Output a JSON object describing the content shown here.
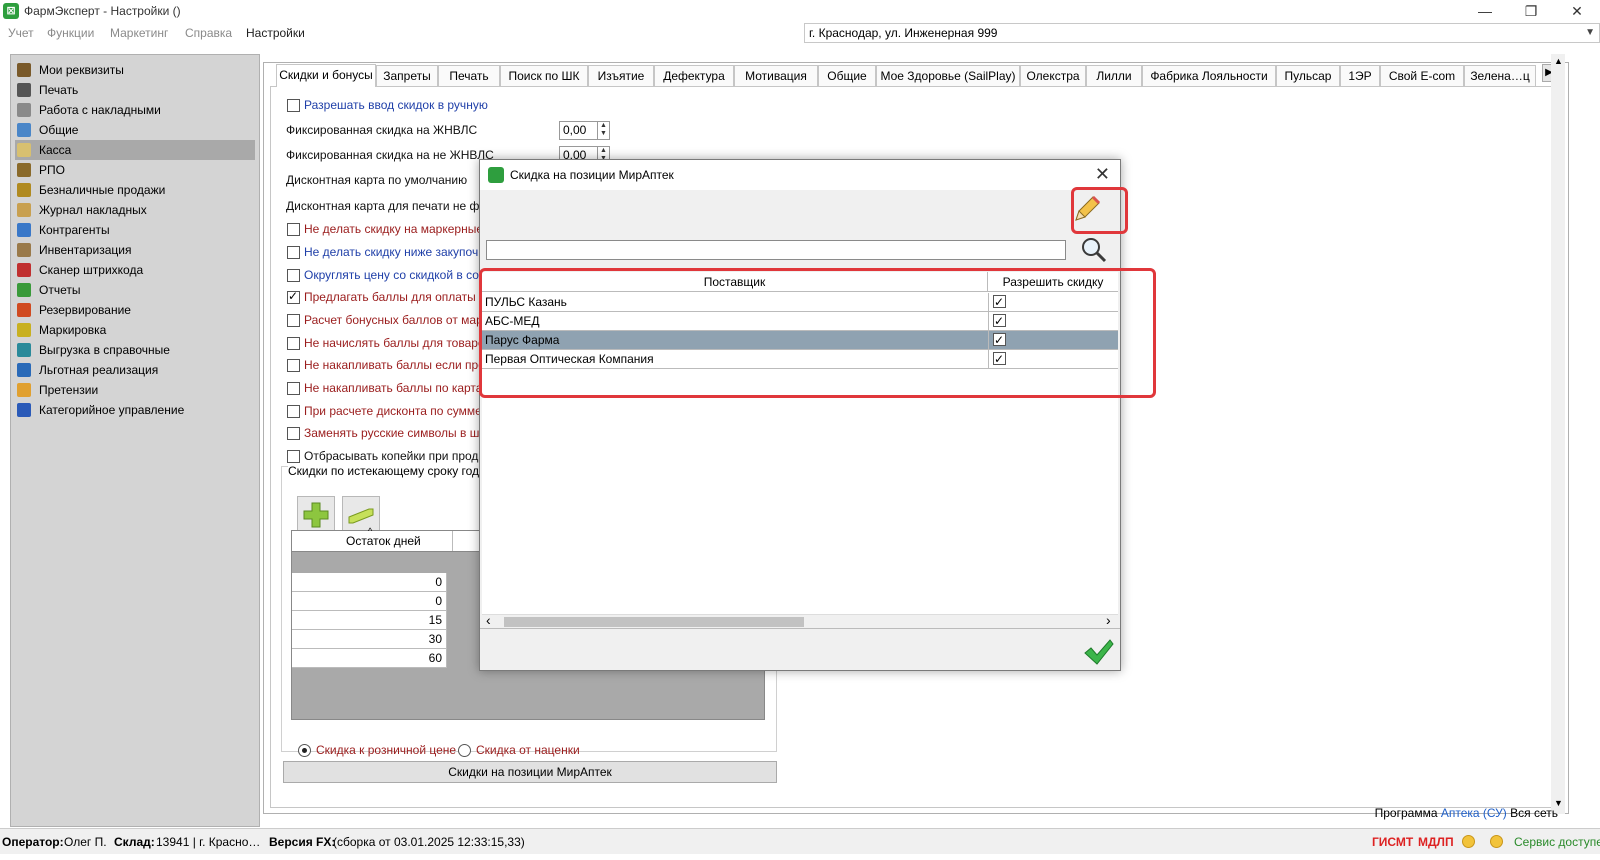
{
  "window": {
    "title": "ФармЭксперт - Настройки ()",
    "minimize": "—",
    "maximize": "❐",
    "close": "✕"
  },
  "menu": [
    "Учет",
    "Функции",
    "Маркетинг",
    "Справка",
    "Настройки"
  ],
  "address": "г. Краснодар, ул. Инженерная 999",
  "sidebar": {
    "items": [
      {
        "label": "Мои реквизиты",
        "color": "#7a5a2a"
      },
      {
        "label": "Печать",
        "color": "#555555"
      },
      {
        "label": "Работа с накладными",
        "color": "#8a8a8a"
      },
      {
        "label": "Общие",
        "color": "#4a86c8"
      },
      {
        "label": "Касса",
        "color": "#d8c070",
        "selected": true
      },
      {
        "label": "РПО",
        "color": "#8a6a2a"
      },
      {
        "label": "Безналичные продажи",
        "color": "#b08a20"
      },
      {
        "label": "Журнал накладных",
        "color": "#c8a050"
      },
      {
        "label": "Контрагенты",
        "color": "#3a78c8"
      },
      {
        "label": "Инвентаризация",
        "color": "#9a7a4a"
      },
      {
        "label": "Сканер штрихкода",
        "color": "#c03030"
      },
      {
        "label": "Отчеты",
        "color": "#3a9a3a"
      },
      {
        "label": "Резервирование",
        "color": "#d04a20"
      },
      {
        "label": "Маркировка",
        "color": "#c8b020"
      },
      {
        "label": "Выгрузка в справочные",
        "color": "#2a8a9a"
      },
      {
        "label": "Льготная реализация",
        "color": "#2a6ab8"
      },
      {
        "label": "Претензии",
        "color": "#e0a030"
      },
      {
        "label": "Категорийное управление",
        "color": "#2a5ab8"
      }
    ]
  },
  "tabs": [
    "Скидки и бонусы",
    "Запреты",
    "Печать",
    "Поиск по ШК",
    "Изъятие",
    "Дефектура",
    "Мотивация",
    "Общие",
    "Мое Здоровье (SailPlay)",
    "Олекстра",
    "Лилли",
    "Фабрика Лояльности",
    "Пульсар",
    "1ЭР",
    "Свой E-com",
    "Зелена…ц"
  ],
  "options": [
    {
      "label": "Разрешать ввод скидок в ручную",
      "checked": false,
      "color": "blue"
    },
    {
      "label": "Не делать скидку на маркерные п",
      "checked": false,
      "color": "red"
    },
    {
      "label": "Не делать скидку ниже закупочно",
      "checked": false,
      "color": "blue"
    },
    {
      "label": "Округлять цену со скидкой в соот",
      "checked": false,
      "color": "blue"
    },
    {
      "label": "Предлагать баллы для оплаты",
      "checked": true,
      "color": "red"
    },
    {
      "label": "Расчет бонусных баллов от марж",
      "checked": false,
      "color": "red"
    },
    {
      "label": "Не начислять баллы для товаров",
      "checked": false,
      "color": "red"
    },
    {
      "label": "Не накапливать баллы если проц",
      "checked": false,
      "color": "red"
    },
    {
      "label": "Не накапливать баллы по картам",
      "checked": false,
      "color": "red"
    },
    {
      "label": "При расчете дисконта по сумме на",
      "checked": false,
      "color": "red"
    },
    {
      "label": "Заменять русские символы в штри",
      "checked": false,
      "color": "red"
    },
    {
      "label": "Отбрасывать копейки при продаж",
      "checked": false,
      "color": "black"
    }
  ],
  "fields": {
    "fixed_zhnvls_label": "Фиксированная скидка на ЖНВЛС",
    "fixed_zhnvls_value": "0,00",
    "fixed_not_zhnvls_label": "Фиксированная скидка на не ЖНВЛС",
    "fixed_not_zhnvls_value": "0,00",
    "default_card_label": "Дисконтная карта по умолчанию",
    "print_card_label": "Дисконтная карта для печати не фис"
  },
  "expiry": {
    "title": "Скидки по истекающему сроку годн",
    "column_header": "Остаток дней",
    "sort_indicator": "^",
    "values": [
      "0",
      "0",
      "15",
      "30",
      "60"
    ],
    "radio_retail": "Скидка к розничной цене",
    "radio_markup": "Скидка от наценки",
    "radio_selected": "retail"
  },
  "mir_button": "Скидки на позиции МирАптек",
  "footer": {
    "program_prefix": "Программа",
    "program_link": "Аптека (СУ)",
    "program_suffix": "Вся сеть"
  },
  "status": {
    "operator_label": "Оператор:",
    "operator_value": "Олег П.",
    "warehouse_label": "Склад:",
    "warehouse_value": "13941 | г. Красно…",
    "version_label": "Версия FX:",
    "version_value": "(сборка от 03.01.2025 12:33:15,33)",
    "gismt": "ГИСМТ",
    "mdlp": "МДЛП",
    "service": "Сервис доступен"
  },
  "dialog": {
    "title": "Скидка на позиции МирАптек",
    "close": "✕",
    "search_value": "",
    "columns": [
      "Поставщик",
      "Разрешить скидку"
    ],
    "rows": [
      {
        "supplier": "ПУЛЬС Казань",
        "allow": true
      },
      {
        "supplier": "АБС-МЕД",
        "allow": true
      },
      {
        "supplier": "Парус Фарма",
        "allow": true,
        "selected": true
      },
      {
        "supplier": "Первая Оптическая Компания",
        "allow": true
      }
    ],
    "scroll_left": "‹",
    "scroll_right": "›"
  }
}
